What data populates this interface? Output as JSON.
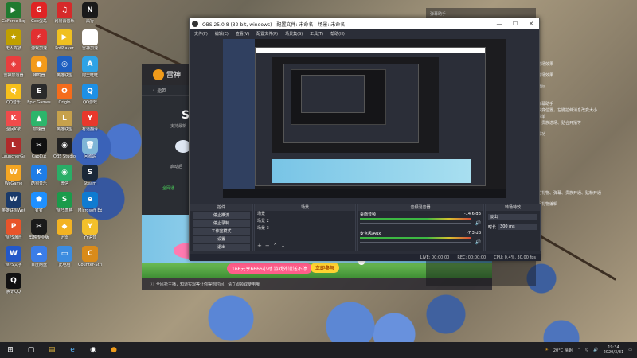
{
  "desktop": {
    "icons": [
      {
        "label": "GeForce Experience",
        "color": "#1f7a2f",
        "glyph": "▶"
      },
      {
        "label": "Geo蛋岛",
        "color": "#e02424",
        "glyph": "G"
      },
      {
        "label": "网易云音乐",
        "color": "#d62a2a",
        "glyph": "♫"
      },
      {
        "label": "风行",
        "color": "#1a1a1a",
        "glyph": "N"
      },
      {
        "label": "无人驾驶",
        "color": "#c0a000",
        "glyph": "★"
      },
      {
        "label": "游戏加速",
        "color": "#e23030",
        "glyph": "⚡"
      },
      {
        "label": "PotPlayer",
        "color": "#f0c020",
        "glyph": "▶"
      },
      {
        "label": "雷神加速",
        "color": "#ffffff",
        "glyph": "◢"
      },
      {
        "label": "雷神加速器",
        "color": "#e83e3e",
        "glyph": "◈"
      },
      {
        "label": "蜂鸣器",
        "color": "#f39a1a",
        "glyph": "●"
      },
      {
        "label": "英雄联盟",
        "color": "#1e5fc0",
        "glyph": "◎"
      },
      {
        "label": "阿里旺旺",
        "color": "#2fa3e6",
        "glyph": "A"
      },
      {
        "label": "QQ音乐",
        "color": "#f7c01b",
        "glyph": "Q"
      },
      {
        "label": "Epic Games",
        "color": "#2a2a2a",
        "glyph": "E"
      },
      {
        "label": "Origin",
        "color": "#f56c1b",
        "glyph": "O"
      },
      {
        "label": "QQ游戏",
        "color": "#1d90e6",
        "glyph": "Q"
      },
      {
        "label": "全民K歌",
        "color": "#f04b4b",
        "glyph": "K"
      },
      {
        "label": "加速器",
        "color": "#2db56b",
        "glyph": "▲"
      },
      {
        "label": "英雄联盟",
        "color": "#c7a14b",
        "glyph": "L"
      },
      {
        "label": "有道翻译",
        "color": "#e8382c",
        "glyph": "Y"
      },
      {
        "label": "LauncherGame",
        "color": "#b02a2a",
        "glyph": "L"
      },
      {
        "label": "CapCut",
        "color": "#111",
        "glyph": "✂"
      },
      {
        "label": "OBS Studio",
        "color": "#222",
        "glyph": "◉"
      },
      {
        "label": "回收站",
        "color": "#7fb5d6",
        "glyph": "🗑"
      },
      {
        "label": "WeGame",
        "color": "#f5a623",
        "glyph": "W"
      },
      {
        "label": "酷狗音乐",
        "color": "#1e7de6",
        "glyph": "K"
      },
      {
        "label": "微信",
        "color": "#2aae67",
        "glyph": "◉"
      },
      {
        "label": "Steam",
        "color": "#1b2838",
        "glyph": "S"
      },
      {
        "label": "英雄联盟WeGame",
        "color": "#1a3a6a",
        "glyph": "W"
      },
      {
        "label": "钉钉",
        "color": "#1e90ff",
        "glyph": "⬟"
      },
      {
        "label": "WPS表格",
        "color": "#1b9b4b",
        "glyph": "S"
      },
      {
        "label": "Microsoft Edge",
        "color": "#0f7bd1",
        "glyph": "e"
      },
      {
        "label": "WPS演示",
        "color": "#e8542a",
        "glyph": "P"
      },
      {
        "label": "剪映专业版",
        "color": "#1a1a1a",
        "glyph": "✂"
      },
      {
        "label": "迅雷",
        "color": "#f3b323",
        "glyph": "◆"
      },
      {
        "label": "YY语音",
        "color": "#f3c02b",
        "glyph": "Y"
      },
      {
        "label": "WPS文字",
        "color": "#2358c8",
        "glyph": "W"
      },
      {
        "label": "百度网盘",
        "color": "#3b7de8",
        "glyph": "☁"
      },
      {
        "label": "此电脑",
        "color": "#3c8ce0",
        "glyph": "▭"
      },
      {
        "label": "Counter-Strike",
        "color": "#d98b1a",
        "glyph": "C"
      },
      {
        "label": "腾讯QQ",
        "color": "#111",
        "glyph": "Q"
      }
    ]
  },
  "leishen": {
    "brand": "雷神",
    "back_label": "返回",
    "s_letter": "St",
    "line1": "支持最新",
    "line2": "启动后",
    "line3": "全网通"
  },
  "ad": {
    "text": "166元享6666小时 游戏外设送不停",
    "cta": "立即参与",
    "notice": "全民抢主播，知道实现等让你得到时间，请立即领取使用哦"
  },
  "chat": {
    "title": "弹幕助手",
    "messages": [
      "这是展示永久进场效果",
      "这是展示永久进场效果",
      "欢迎来到本直播间",
      "欢迎使用斗鱼弹幕助手",
      "左键拖拽消息改变位置，左键拉伸消息改变大小",
      "右上角有设置菜单",
      "这里展示弹幕、贵族进场、贴合开播等",
      "添加弹幕助手成功",
      "这里展示收到的礼物、弹幕、贵族开通、贴粉开通",
      "在此单可以进行礼物编辑"
    ]
  },
  "obs": {
    "title": "OBS 25.0.8 (32-bit, windows) - 配置文件: 未命名 - 场景: 未命名",
    "menu": [
      "文件(F)",
      "编辑(E)",
      "查看(V)",
      "配置文件(P)",
      "场景集(S)",
      "工具(T)",
      "帮助(H)"
    ],
    "docks": {
      "controls_title": "控件",
      "controls": [
        "停止推流",
        "停止录制",
        "工作室模式",
        "设置",
        "退出"
      ],
      "scenes_title": "场景",
      "scenes": [
        "场景",
        "场景 2",
        "场景 3"
      ],
      "mixer_title": "音频混音器",
      "mixer": [
        {
          "name": "桌面音频",
          "db": "-14.6 dB"
        },
        {
          "name": "麦克风/Aux",
          "db": "-7.3 dB"
        }
      ],
      "transitions_title": "转场特效",
      "transition_name": "淡出",
      "duration_label": "时长",
      "duration_value": "300 ms"
    },
    "status": {
      "live": "LIVE: 00:00:00",
      "rec": "REC: 00:00:00",
      "cpu": "CPU: 0.4%, 30.00 fps"
    }
  },
  "taskbar": {
    "weather": "20°C 晴朗",
    "time": "19:34",
    "date": "2020/3/31"
  }
}
